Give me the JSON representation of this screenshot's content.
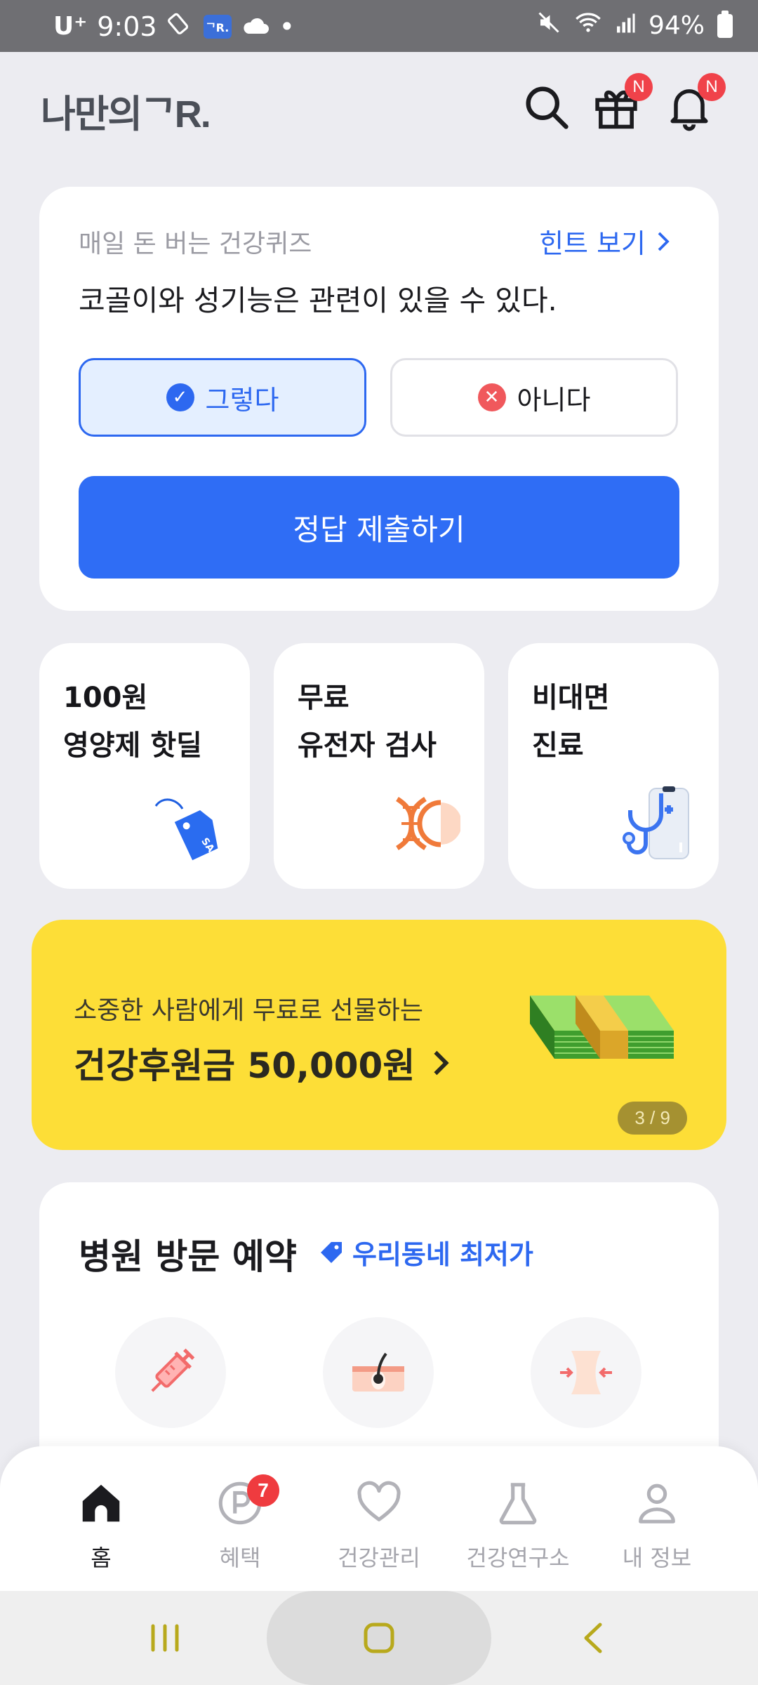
{
  "status_bar": {
    "carrier": "U⁺",
    "time": "9:03",
    "app_badge": "ᄀR.",
    "dot": "•",
    "battery": "94%"
  },
  "header": {
    "logo": "나만의ᄀR.",
    "gift_badge": "N",
    "bell_badge": "N"
  },
  "quiz": {
    "label": "매일 돈 버는 건강퀴즈",
    "hint": "힌트 보기",
    "question": "코골이와 성기능은 관련이 있을 수 있다.",
    "option_yes": "그렇다",
    "option_no": "아니다",
    "selected": "yes",
    "submit": "정답 제출하기"
  },
  "tiles": [
    {
      "title": "100원\n영양제 핫딜",
      "icon": "sale-tag-icon"
    },
    {
      "title": "무료\n유전자 검사",
      "icon": "dna-icon"
    },
    {
      "title": "비대면\n진료",
      "icon": "stethoscope-icon"
    }
  ],
  "banner": {
    "subtitle": "소중한 사람에게 무료로 선물하는",
    "title": "건강후원금 50,000원",
    "counter": "3 / 9",
    "color": "#fdde37"
  },
  "clinic": {
    "title": "병원 방문 예약",
    "tag": "우리동네 최저가",
    "icons": [
      "syringe-icon",
      "skin-follicle-icon",
      "waist-slimming-icon"
    ]
  },
  "bottom_nav": {
    "items": [
      {
        "label": "홈",
        "icon": "home-icon",
        "active": true
      },
      {
        "label": "혜택",
        "icon": "points-icon",
        "badge": "7"
      },
      {
        "label": "건강관리",
        "icon": "heart-icon"
      },
      {
        "label": "건강연구소",
        "icon": "flask-icon"
      },
      {
        "label": "내 정보",
        "icon": "person-icon"
      }
    ]
  },
  "colors": {
    "accent": "#2f6df5",
    "badge_red": "#f0424a",
    "background": "#ECECF1"
  }
}
